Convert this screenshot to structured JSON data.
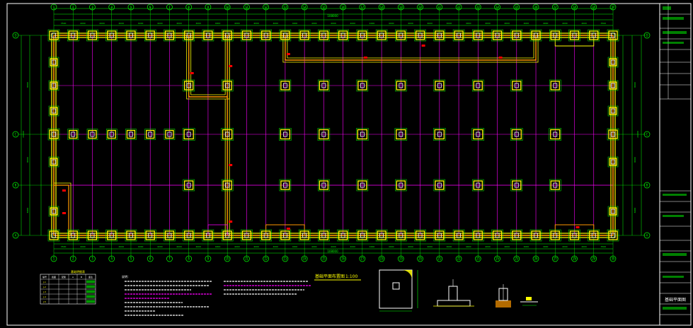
{
  "drawing": {
    "plan_title": "基础平面布置图",
    "plan_scale": "1:100",
    "total_length_top": "108000",
    "total_length_bottom": "108000",
    "total_width": "24000"
  },
  "grid": {
    "columns": [
      "1",
      "2",
      "3",
      "4",
      "5",
      "6",
      "7",
      "8",
      "9",
      "10",
      "11",
      "12",
      "13",
      "14",
      "15",
      "16",
      "17",
      "18",
      "19",
      "20",
      "21",
      "22",
      "23",
      "24",
      "25",
      "26",
      "27",
      "28",
      "29",
      "30"
    ],
    "rows": [
      "A",
      "B",
      "C",
      "D"
    ]
  },
  "dimensions": {
    "top_span_labels": [
      "3500",
      "4000",
      "4000",
      "4000",
      "4000",
      "4000",
      "4000",
      "4000",
      "4000",
      "4000",
      "4000",
      "4000",
      "4000",
      "4000",
      "4000",
      "4000",
      "4000",
      "4000",
      "4000",
      "4000",
      "4000",
      "4000",
      "4000",
      "4000",
      "4000",
      "4000",
      "4000",
      "4000",
      "3500"
    ],
    "left_span_labels": [
      "8000",
      "8000",
      "8000"
    ]
  },
  "legend_table": {
    "title": "基础明细表",
    "headers": [
      "编号",
      "截面",
      "配筋",
      "A",
      "B",
      "备注"
    ],
    "rows": [
      [
        "J-1",
        "",
        "",
        "",
        "",
        ""
      ],
      [
        "J-2",
        "",
        "",
        "",
        "",
        ""
      ],
      [
        "J-3",
        "",
        "",
        "",
        "",
        ""
      ],
      [
        "J-4",
        "",
        "",
        "",
        "",
        ""
      ],
      [
        "J-5",
        "",
        "",
        "",
        "",
        ""
      ]
    ]
  },
  "notes": {
    "title": "说明："
  },
  "title_block": {
    "sheet_label": "基础平面图"
  },
  "colors": {
    "background": "#000000",
    "grid_green": "#00ff00",
    "axis_magenta": "#ff00ff",
    "foundation_yellow": "#ffff00",
    "beam_orange": "#ff9900",
    "column_white": "#ffffff",
    "tag_red": "#ff0000"
  }
}
